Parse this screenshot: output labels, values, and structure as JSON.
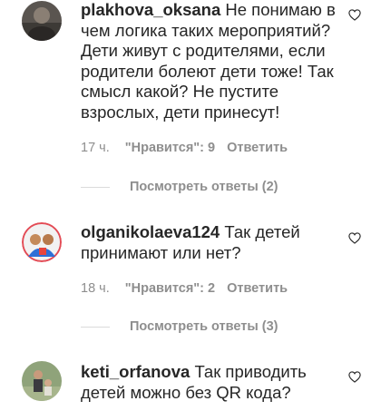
{
  "comments": [
    {
      "username": "plakhova_oksana",
      "text": "Не понимаю в чем логика таких мероприятий? Дети живут с родителями, если родители болеют дети тоже! Так смысл какой? Не пустите взрослых, дети принесут!",
      "time": "17 ч.",
      "likes": "\"Нравится\": 9",
      "reply_label": "Ответить",
      "view_replies": "Посмотреть ответы (2)"
    },
    {
      "username": "olganikolaeva124",
      "text": "Так детей принимают или нет?",
      "time": "18 ч.",
      "likes": "\"Нравится\": 2",
      "reply_label": "Ответить",
      "view_replies": "Посмотреть ответы (3)"
    },
    {
      "username": "keti_orfanova",
      "text": "Так приводить детей можно без QR кода?"
    }
  ],
  "colors": {
    "primary_text": "#262626",
    "secondary_text": "#8e8e8e",
    "divider": "#dbdbdb"
  },
  "icons": [
    "heart-outline-icon"
  ]
}
